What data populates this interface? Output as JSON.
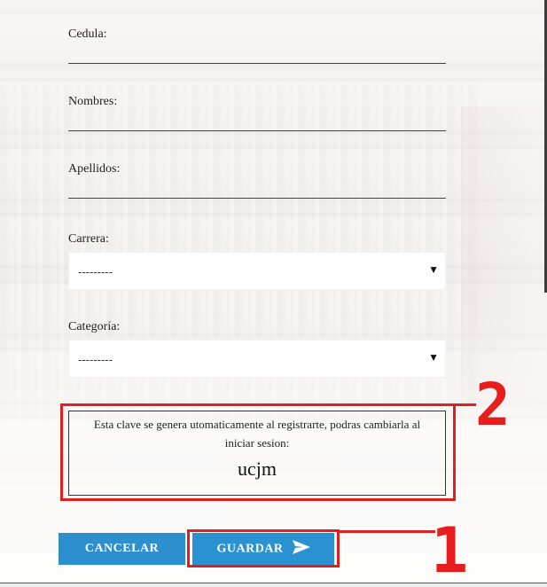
{
  "form": {
    "cedula_label": "Cedula:",
    "nombres_label": "Nombres:",
    "apellidos_label": "Apellidos:",
    "carrera_label": "Carrera:",
    "carrera_value": "---------",
    "categoria_label": "Categoría:",
    "categoria_value": "---------"
  },
  "info": {
    "message": "Esta clave se genera utomaticamente al registrarte, podras cambiarla al iniciar sesion:",
    "code": "ucjm"
  },
  "buttons": {
    "cancel_label": "CANCELAR",
    "save_label": "GUARDAR",
    "save_icon": "send-icon"
  },
  "annotations": {
    "one": "1",
    "two": "2",
    "color": "#e02020"
  }
}
